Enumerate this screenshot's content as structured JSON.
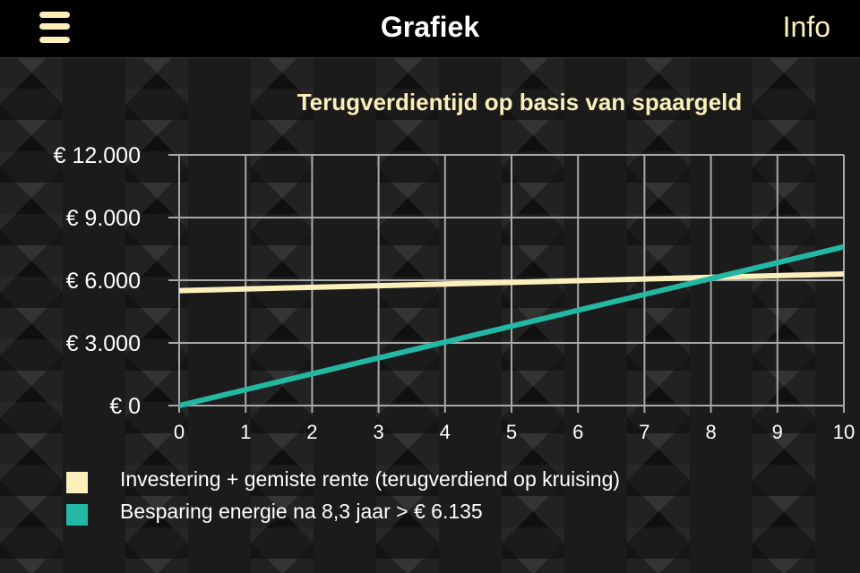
{
  "navbar": {
    "menu_icon": "hamburger-menu-icon",
    "title": "Grafiek",
    "info_label": "Info"
  },
  "colors": {
    "accent": "#fbefb8",
    "series_investment": "#fbf0bb",
    "series_savings": "#22b8a4",
    "grid": "#a8a8a8"
  },
  "chart_data": {
    "type": "line",
    "title": "Terugverdientijd op basis van spaargeld",
    "xlabel": "",
    "ylabel": "",
    "x": [
      0,
      1,
      2,
      3,
      4,
      5,
      6,
      7,
      8,
      9,
      10
    ],
    "x_ticks": [
      "0",
      "1",
      "2",
      "3",
      "4",
      "5",
      "6",
      "7",
      "8",
      "9",
      "10"
    ],
    "y_ticks": [
      {
        "value": 0,
        "label": "€ 0"
      },
      {
        "value": 3000,
        "label": "€ 3.000"
      },
      {
        "value": 6000,
        "label": "€ 6.000"
      },
      {
        "value": 9000,
        "label": "€ 9.000"
      },
      {
        "value": 12000,
        "label": "€ 12.000"
      }
    ],
    "xlim": [
      0,
      10
    ],
    "ylim": [
      0,
      12000
    ],
    "grid": true,
    "legend_position": "bottom-left",
    "series": [
      {
        "name": "Investering + gemiste rente (terugverdiend op kruising)",
        "color": "#fbf0bb",
        "values": [
          5500,
          5580,
          5660,
          5740,
          5820,
          5900,
          5980,
          6060,
          6140,
          6220,
          6300
        ]
      },
      {
        "name": "Besparing energie na 8,3 jaar > € 6.135",
        "color": "#22b8a4",
        "values": [
          0,
          760,
          1520,
          2280,
          3040,
          3800,
          4560,
          5320,
          6080,
          6840,
          7600
        ]
      }
    ]
  },
  "legend": {
    "items": [
      {
        "label": "Investering + gemiste rente (terugverdiend op kruising)",
        "color": "#fbf0bb"
      },
      {
        "label": "Besparing energie na 8,3 jaar > € 6.135",
        "color": "#22b8a4"
      }
    ]
  }
}
